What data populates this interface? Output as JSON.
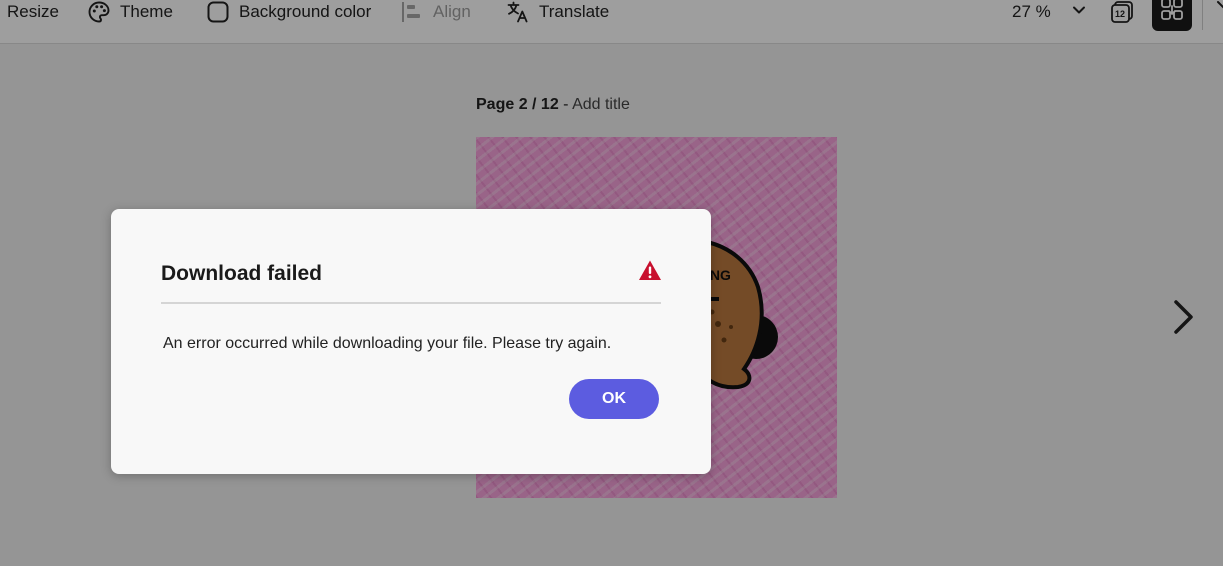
{
  "toolbar": {
    "resize_label": "Resize",
    "theme_label": "Theme",
    "background_color_label": "Background color",
    "align_label": "Align",
    "translate_label": "Translate",
    "zoom_value": "27 %",
    "page_count_badge": "12"
  },
  "canvas": {
    "page_number": "Page 2 / 12",
    "separator": " - ",
    "page_title_placeholder": "Add title",
    "thumbnail_text": "ING"
  },
  "dialog": {
    "title": "Download failed",
    "message": "An error occurred while downloading your file. Please try again.",
    "ok_label": "OK"
  },
  "colors": {
    "accent": "#5c5ce0",
    "alert": "#c8102e",
    "thumbnail_pink": "#f7a2db"
  },
  "icons": {
    "theme": "palette-icon",
    "background_color": "square-outline-icon",
    "align": "align-left-icon",
    "translate": "translate-icon",
    "zoom_menu": "chevron-down-icon",
    "pages": "pages-icon",
    "grid": "grid-view-icon",
    "next": "chevron-right-icon",
    "alert": "alert-triangle-icon"
  }
}
